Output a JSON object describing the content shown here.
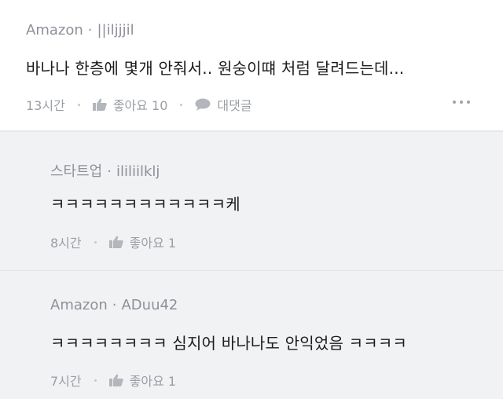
{
  "comments": [
    {
      "author": "Amazon",
      "handle": "||iljjjil",
      "text": "바나나 한층에 몇개 안줘서.. 원숭이떄 처럼 달려드는데...",
      "time": "13시간",
      "like_label": "좋아요 10",
      "reply_label": "대댓글"
    }
  ],
  "replies": [
    {
      "author": "스타트업",
      "handle": "ililiilklj",
      "text": "ㅋㅋㅋㅋㅋㅋㅋㅋㅋㅋㅋㅋ케",
      "time": "8시간",
      "like_label": "좋아요 1"
    },
    {
      "author": "Amazon",
      "handle": "ADuu42",
      "text": "ㅋㅋㅋㅋㅋㅋㅋㅋ 심지어 바나나도 안익었음 ㅋㅋㅋㅋ",
      "time": "7시간",
      "like_label": "좋아요 1"
    }
  ],
  "meta_separator": "·",
  "icons": {
    "like": "thumbs-up-icon",
    "reply": "speech-bubble-icon",
    "more": "more-options-icon"
  },
  "colors": {
    "meta": "#8d9198",
    "text": "#1c1c1c",
    "reply_bg": "#f1f2f4"
  }
}
